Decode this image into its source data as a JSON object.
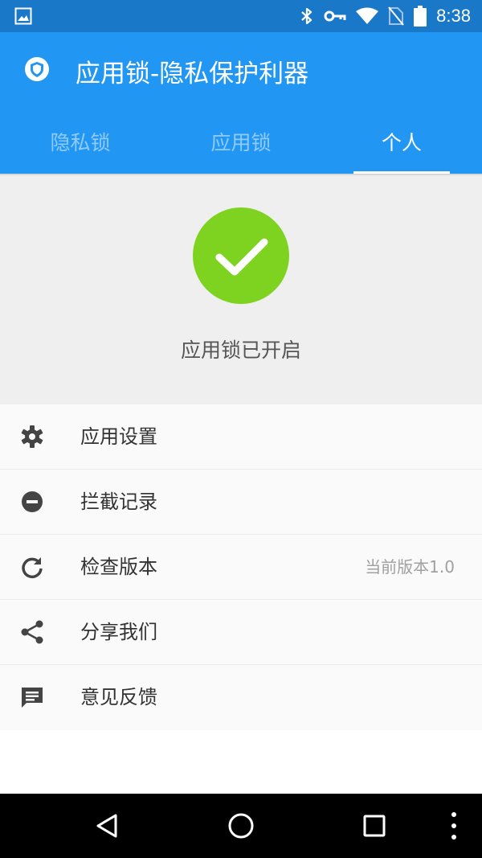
{
  "status_bar": {
    "time": "8:38",
    "icons": [
      "image-notification-icon",
      "bluetooth-icon",
      "vpn-key-icon",
      "wifi-icon",
      "no-sim-icon",
      "battery-icon"
    ]
  },
  "app_bar": {
    "title": "应用锁-隐私保护利器",
    "logo_icon": "shield-icon"
  },
  "tabs": [
    {
      "label": "隐私锁",
      "active": false
    },
    {
      "label": "应用锁",
      "active": false
    },
    {
      "label": "个人",
      "active": true
    }
  ],
  "hero": {
    "status_text": "应用锁已开启",
    "icon": "check-icon",
    "color": "#7ed321"
  },
  "menu": [
    {
      "label": "应用设置",
      "icon": "gear-icon"
    },
    {
      "label": "拦截记录",
      "icon": "minus-circle-icon"
    },
    {
      "label": "检查版本",
      "icon": "refresh-icon",
      "meta": "当前版本1.0"
    },
    {
      "label": "分享我们",
      "icon": "share-icon"
    },
    {
      "label": "意见反馈",
      "icon": "message-icon"
    }
  ],
  "colors": {
    "primary": "#2196f3",
    "status_bar": "#1a78c9",
    "success": "#7ed321"
  }
}
